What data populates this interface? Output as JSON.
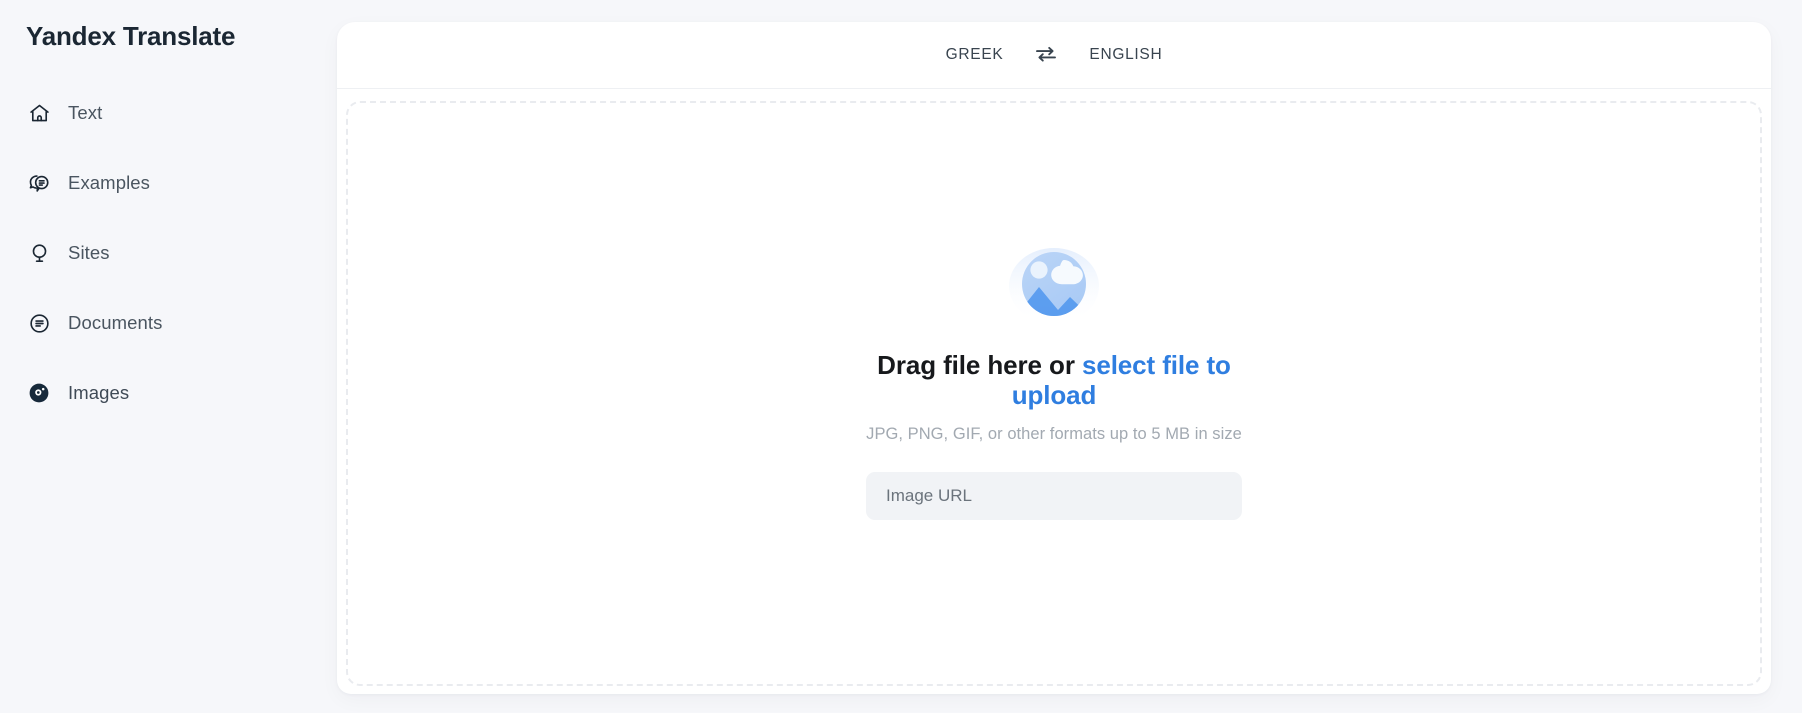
{
  "app": {
    "title": "Yandex Translate",
    "background_color": "#f6f7fa",
    "panel_color": "#ffffff"
  },
  "sidebar": {
    "brand": "Yandex Translate",
    "items": [
      {
        "label": "Text",
        "icon": "home-icon",
        "active": false
      },
      {
        "label": "Examples",
        "icon": "chat-bubbles-icon",
        "active": false
      },
      {
        "label": "Sites",
        "icon": "globe-stand-icon",
        "active": false
      },
      {
        "label": "Documents",
        "icon": "document-circle-icon",
        "active": false
      },
      {
        "label": "Images",
        "icon": "images-camera-icon",
        "active": true
      }
    ]
  },
  "language_bar": {
    "source_language": "GREEK",
    "target_language": "ENGLISH",
    "swap_icon": "swap-arrows-icon"
  },
  "dropzone": {
    "illustration_icon": "image-placeholder-icon",
    "title_prefix": "Drag file here or ",
    "title_link": "select file to upload",
    "subtitle": "JPG, PNG, GIF, or other formats up to 5 MB in size",
    "url_input_placeholder": "Image URL",
    "url_input_value": ""
  },
  "colors": {
    "accent_link": "#2f7ee0",
    "text_primary": "#17191c",
    "text_secondary": "#4a5560",
    "text_muted": "#a2a9b1",
    "input_background": "#f1f3f6",
    "dashed_border": "#e9ebef"
  }
}
